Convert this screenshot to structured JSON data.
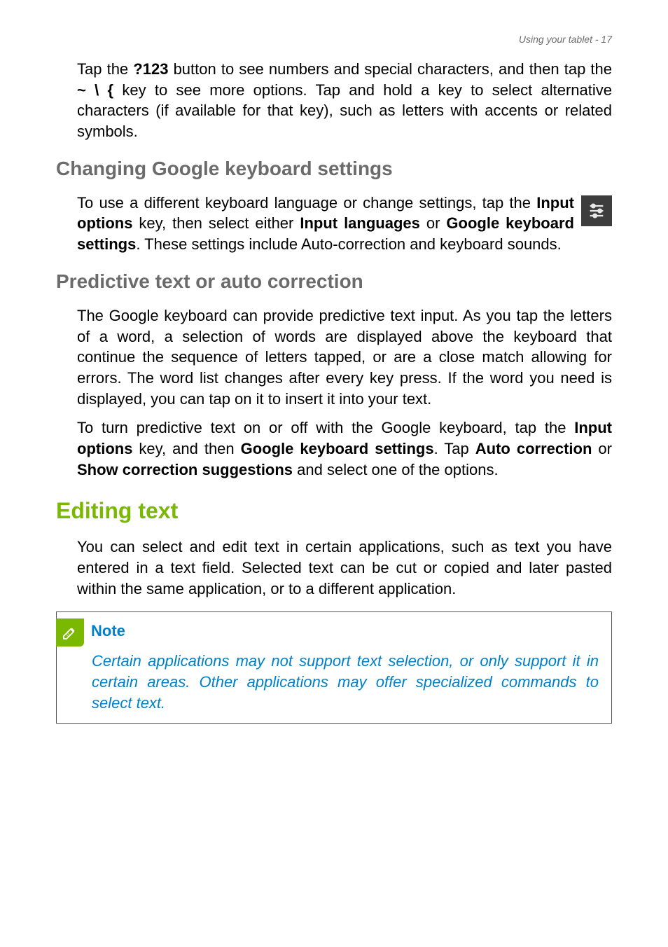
{
  "header": {
    "text": "Using your tablet - 17"
  },
  "paragraphs": {
    "p1_a": "Tap the ",
    "p1_b": "?123",
    "p1_c": " button to see numbers and special characters, and then tap the ",
    "p1_d": "~ \\ {",
    "p1_e": " key to see more options. Tap and hold a key to select alternative characters (if available for that key), such as letters with accents or related symbols."
  },
  "h2a": "Changing Google keyboard settings",
  "p2": {
    "a": "To use a different keyboard language or change settings, tap the ",
    "b": "Input options",
    "c": " key, then select either ",
    "d": "Input languages",
    "e": " or ",
    "f": "Google keyboard settings",
    "g": ". These settings include Auto-correction and keyboard sounds."
  },
  "h2b": "Predictive text or auto correction",
  "p3": "The Google keyboard can provide predictive text input. As you tap the letters of a word, a selection of words are displayed above the keyboard that continue the sequence of letters tapped, or are a close match allowing for errors. The word list changes after every key press. If the word you need is displayed, you can tap on it to insert it into your text.",
  "p4": {
    "a": "To turn predictive text on or off with the Google keyboard, tap the ",
    "b": "Input options",
    "c": " key, and then ",
    "d": "Google keyboard settings",
    "e": ". Tap ",
    "f": "Auto correction",
    "g": " or ",
    "h": "Show correction suggestions",
    "i": " and select one of the options."
  },
  "h1": "Editing text",
  "p5": "You can select and edit text in certain applications, such as text you have entered in a text field. Selected text can be cut or copied and later pasted within the same application, or to a different application.",
  "note": {
    "title": "Note",
    "body": "Certain applications may not support text selection, or only support it in certain areas. Other applications may offer specialized commands to select text."
  }
}
